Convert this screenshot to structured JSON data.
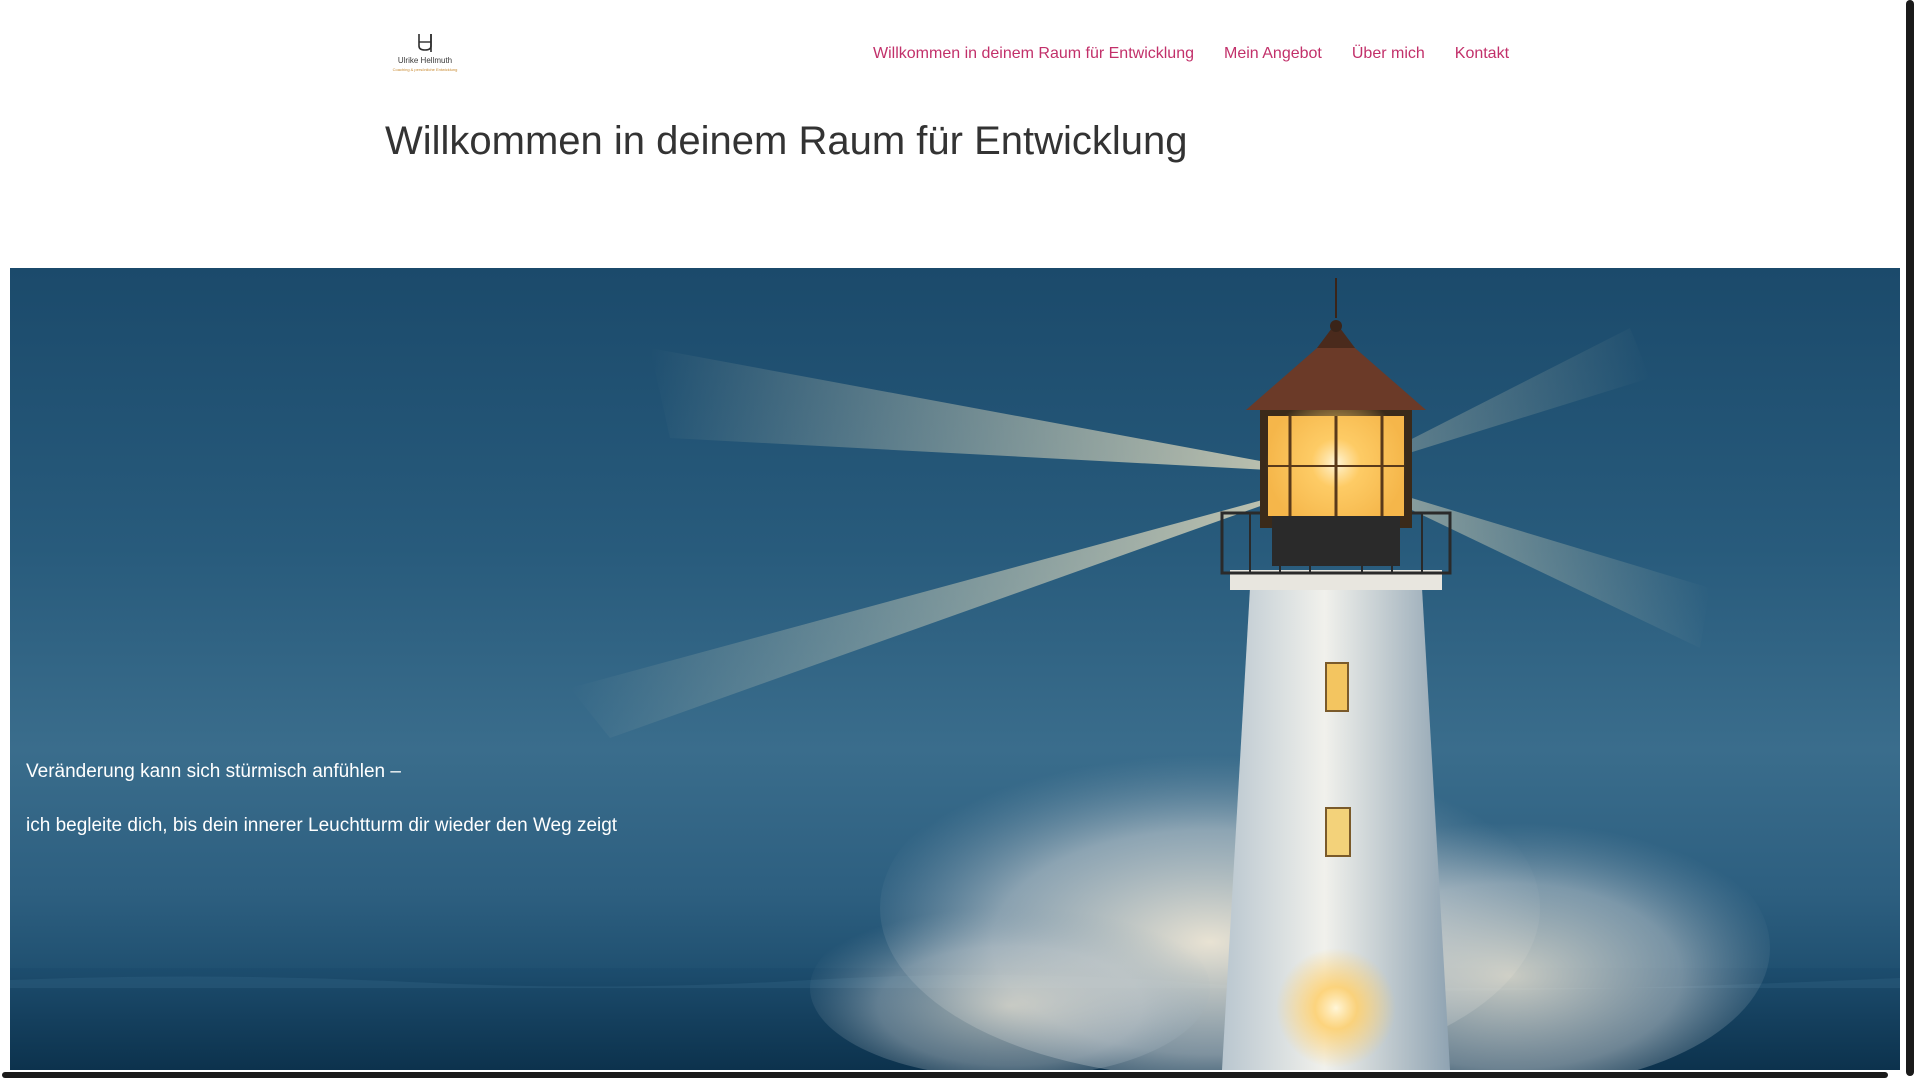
{
  "logo": {
    "name": "Ulrike Hellmuth",
    "tagline": "Coaching & persönliche Entwicklung",
    "mark_icon": "uh-monogram-icon"
  },
  "nav": {
    "items": [
      {
        "label": "Willkommen in deinem Raum für Entwicklung"
      },
      {
        "label": "Mein Angebot"
      },
      {
        "label": "Über mich"
      },
      {
        "label": "Kontakt"
      }
    ]
  },
  "page": {
    "title": "Willkommen in deinem Raum für Entwicklung"
  },
  "hero": {
    "image": "lighthouse-storm-image",
    "line1": "Veränderung kann sich stürmisch anfühlen –",
    "line2": "ich begleite dich, bis dein innerer Leuchtturm dir wieder den Weg zeigt"
  },
  "colors": {
    "nav_link": "#c2306a",
    "title_text": "#333333",
    "hero_sky": "#285b7c",
    "hero_text": "#ffffff"
  }
}
